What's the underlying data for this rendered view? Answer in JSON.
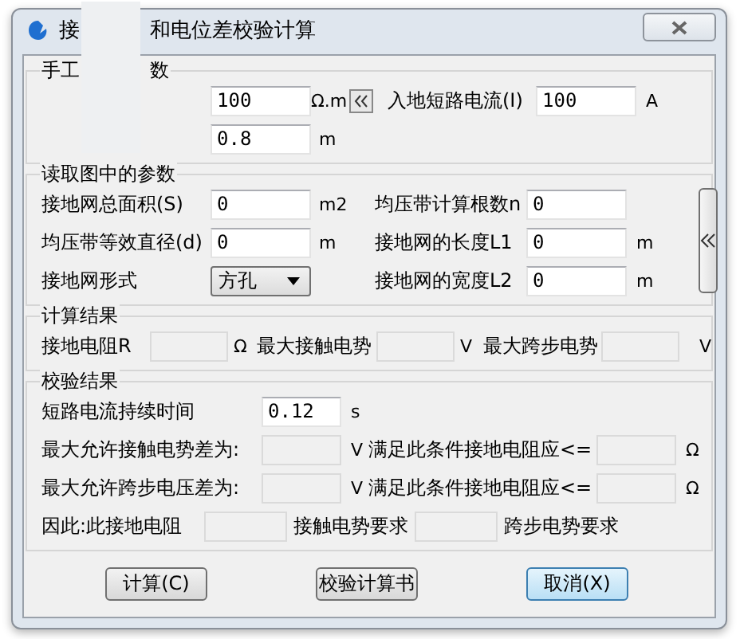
{
  "window": {
    "title_start": "接",
    "title_end": "和电位差校验计算"
  },
  "manual": {
    "heading_start": "手工",
    "heading_end": "数",
    "resistivity": {
      "value": "100",
      "unit": "Ω.m"
    },
    "current": {
      "label": "入地短路电流(I)",
      "value": "100",
      "unit": "A"
    },
    "depth": {
      "value": "0.8",
      "unit": "m"
    }
  },
  "read": {
    "heading": "读取图中的参数",
    "left": [
      {
        "kind": "field",
        "label": "接地网总面积(S)",
        "value": "0",
        "unit": "m2"
      },
      {
        "kind": "field",
        "label": "均压带等效直径(d)",
        "value": "0",
        "unit": "m"
      },
      {
        "kind": "combo",
        "label": "接地网形式",
        "value": "方孔"
      }
    ],
    "right": [
      {
        "label": "均压带计算根数n",
        "value": "0"
      },
      {
        "label": "接地网的长度L1",
        "value": "0",
        "unit": "m"
      },
      {
        "label": "接地网的宽度L2",
        "value": "0",
        "unit": "m"
      }
    ]
  },
  "result": {
    "heading": "计算结果",
    "items": [
      {
        "label": "接地电阻R",
        "unit": "Ω"
      },
      {
        "label": "最大接触电势",
        "unit": "V"
      },
      {
        "label": "最大跨步电势",
        "unit": "V"
      }
    ]
  },
  "check": {
    "heading": "校验结果",
    "duration": {
      "label": "短路电流持续时间",
      "value": "0.12",
      "unit": "s"
    },
    "limits": [
      {
        "label": "最大允许接触电势差为:",
        "unit": "V",
        "cond": "满足此条件接地电阻应<=",
        "cond_unit": "Ω"
      },
      {
        "label": "最大允许跨步电压差为:",
        "unit": "V",
        "cond": "满足此条件接地电阻应<=",
        "cond_unit": "Ω"
      }
    ],
    "verdict": {
      "label": "因此:此接地电阻",
      "touch": "接触电势要求",
      "step": "跨步电势要求"
    }
  },
  "buttons": [
    {
      "label": "计算(C)",
      "default": false
    },
    {
      "label": "校验计算书",
      "default": false
    },
    {
      "label": "取消(X)",
      "default": true
    }
  ]
}
